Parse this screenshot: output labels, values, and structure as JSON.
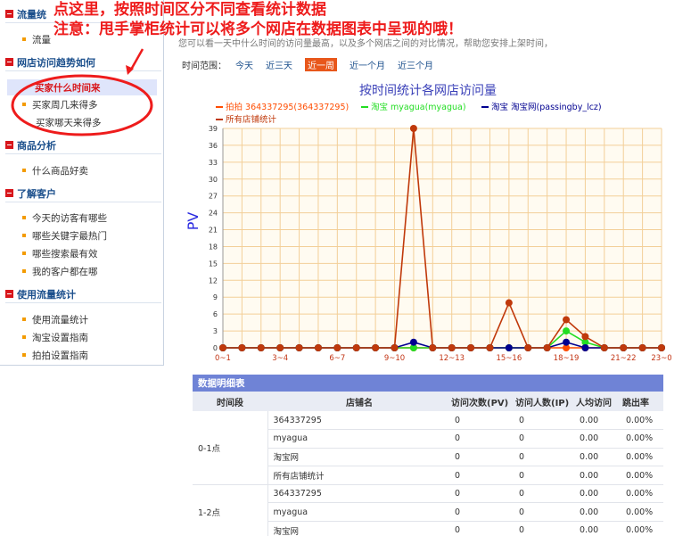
{
  "sidebar": {
    "sections": [
      {
        "title": "流量统",
        "items": [
          {
            "label": "流量"
          }
        ]
      },
      {
        "title": "网店访问趋势如何",
        "items": [
          {
            "label": "买家什么时间来"
          },
          {
            "label": "买家周几来得多"
          },
          {
            "label": "买家哪天来得多"
          }
        ]
      },
      {
        "title": "商品分析",
        "items": [
          {
            "label": "什么商品好卖"
          }
        ]
      },
      {
        "title": "了解客户",
        "items": [
          {
            "label": "今天的访客有哪些"
          },
          {
            "label": "哪些关键字最热门"
          },
          {
            "label": "哪些搜索最有效"
          },
          {
            "label": "我的客户都在哪"
          }
        ]
      },
      {
        "title": "使用流量统计",
        "items": [
          {
            "label": "使用流量统计"
          },
          {
            "label": "淘宝设置指南"
          },
          {
            "label": "拍拍设置指南"
          }
        ]
      }
    ]
  },
  "annotations": {
    "line1": "点这里，按照时间区分不同查看统计数据",
    "line2": "注意：甩手掌柜统计可以将多个网店在数据图表中呈现的哦！"
  },
  "main": {
    "cut_text": "您可以看一天中什么时间的访问量最高，以及多个网店之间的对比情况，帮助您安排上架时间，同时可以对比不同网店的流量",
    "time_range": {
      "label": "时间范围：",
      "options": [
        "今天",
        "近三天",
        "近一周",
        "近一个月",
        "近三个月"
      ],
      "active": "近一周"
    }
  },
  "chart_data": {
    "type": "line",
    "title": "按时间统计各网店访问量",
    "ylabel": "PV",
    "xlabel": "",
    "ylim": [
      0,
      39
    ],
    "yticks": [
      0,
      3,
      6,
      9,
      12,
      15,
      18,
      21,
      24,
      27,
      30,
      33,
      36,
      39
    ],
    "categories": [
      "0~1",
      "1~2",
      "2~3",
      "3~4",
      "4~5",
      "5~6",
      "6~7",
      "7~8",
      "8~9",
      "9~10",
      "10~11",
      "11~12",
      "12~13",
      "13~14",
      "14~15",
      "15~16",
      "16~17",
      "17~18",
      "18~19",
      "19~20",
      "20~21",
      "21~22",
      "22~23",
      "23~0"
    ],
    "xtick_labels": [
      "0~1",
      "3~4",
      "6~7",
      "9~10",
      "12~13",
      "15~16",
      "18~19",
      "21~22",
      "23~0"
    ],
    "legend_position": "top",
    "grid": true,
    "series": [
      {
        "name": "拍拍 364337295(364337295)",
        "color": "#ff4c00",
        "values": [
          0,
          0,
          0,
          0,
          0,
          0,
          0,
          0,
          0,
          0,
          0,
          0,
          0,
          0,
          0,
          0,
          0,
          0,
          0,
          0,
          0,
          0,
          0,
          0
        ]
      },
      {
        "name": "淘宝 myagua(myagua)",
        "color": "#22dd22",
        "values": [
          0,
          0,
          0,
          0,
          0,
          0,
          0,
          0,
          0,
          0,
          0,
          0,
          0,
          0,
          0,
          0,
          0,
          0,
          3,
          1,
          0,
          0,
          0,
          0
        ]
      },
      {
        "name": "淘宝 淘宝网(passingby_lcz)",
        "color": "#000090",
        "values": [
          0,
          0,
          0,
          0,
          0,
          0,
          0,
          0,
          0,
          0,
          1,
          0,
          0,
          0,
          0,
          0,
          0,
          0,
          1,
          0,
          0,
          0,
          0,
          0
        ]
      },
      {
        "name": "所有店铺统计",
        "color": "#c0390b",
        "values": [
          0,
          0,
          0,
          0,
          0,
          0,
          0,
          0,
          0,
          0,
          39,
          0,
          0,
          0,
          0,
          8,
          0,
          0,
          5,
          2,
          0,
          0,
          0,
          0
        ]
      }
    ]
  },
  "table": {
    "caption": "数据明细表",
    "columns": [
      "时间段",
      "店铺名",
      "访问次数(PV)",
      "访问人数(IP)",
      "人均访问",
      "跳出率"
    ],
    "groups": [
      {
        "period": "0-1点",
        "rows": [
          [
            "364337295",
            "0",
            "0",
            "0.00",
            "0.00%"
          ],
          [
            "myagua",
            "0",
            "0",
            "0.00",
            "0.00%"
          ],
          [
            "淘宝网",
            "0",
            "0",
            "0.00",
            "0.00%"
          ],
          [
            "所有店铺统计",
            "0",
            "0",
            "0.00",
            "0.00%"
          ]
        ]
      },
      {
        "period": "1-2点",
        "rows": [
          [
            "364337295",
            "0",
            "0",
            "0.00",
            "0.00%"
          ],
          [
            "myagua",
            "0",
            "0",
            "0.00",
            "0.00%"
          ],
          [
            "淘宝网",
            "0",
            "0",
            "0.00",
            "0.00%"
          ]
        ]
      }
    ]
  },
  "colors": {
    "accent": "#1b4f8c",
    "highlight": "#d8161b",
    "annotation": "#ee1c1c",
    "tableHeader": "#6f83d6"
  }
}
